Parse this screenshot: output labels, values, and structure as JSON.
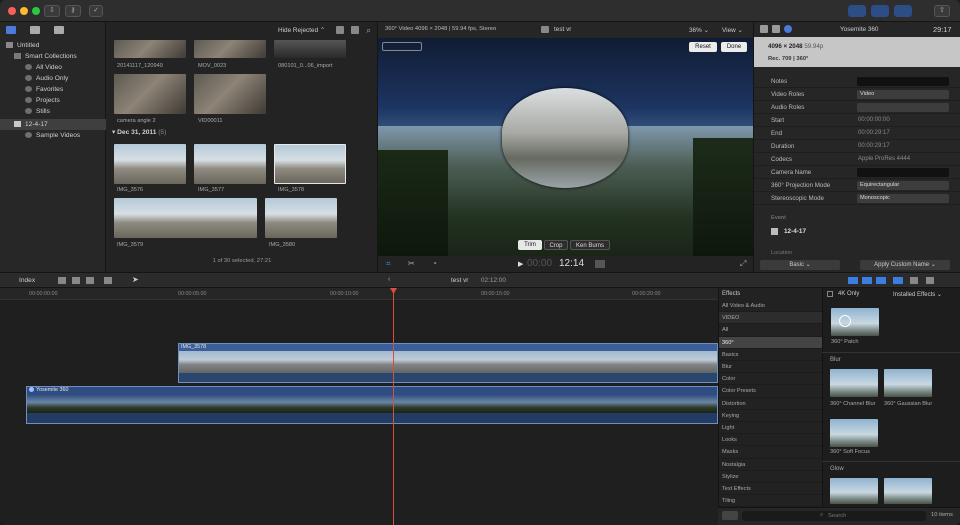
{
  "toolbar": {
    "hide_rejected": "Hide Rejected",
    "zoom": "36%",
    "view": "View",
    "timecode_top": "29:17"
  },
  "sidebar": {
    "library": "Untitled",
    "items": [
      {
        "label": "Smart Collections"
      },
      {
        "label": "All Video"
      },
      {
        "label": "Audio Only"
      },
      {
        "label": "Favorites"
      },
      {
        "label": "Projects"
      },
      {
        "label": "Stills"
      },
      {
        "label": "12-4-17"
      },
      {
        "label": "Sample Videos"
      }
    ]
  },
  "browser": {
    "clips_top": [
      "20141117_120949",
      "MOV_0023",
      "080101_0...06_import"
    ],
    "clips_mid": [
      "camera angle 2",
      "VID00011"
    ],
    "date_header": "Dec 31, 2011",
    "date_count": "(5)",
    "clips_bottom": [
      "IMG_3576",
      "IMG_3577",
      "IMG_3578",
      "IMG_3579",
      "IMG_3580"
    ],
    "status": "1 of 30 selected, 27:21"
  },
  "viewer": {
    "info": "360° Video 4096 × 2048 | 59.94 fps, Stereo",
    "title": "test vr",
    "reset": "Reset",
    "done": "Done",
    "trim": "Trim",
    "crop": "Crop",
    "ken_burns": "Ken Burns",
    "timecode_dim": "00:00",
    "timecode": "12:14"
  },
  "inspector": {
    "title": "Yosemite 360",
    "timecode": "29:17",
    "res": "4096 × 2048",
    "fps": "59.94p",
    "format": "Rec. 709 | 360°",
    "rows": [
      {
        "k": "Notes",
        "v": ""
      },
      {
        "k": "Video Roles",
        "v": "Video"
      },
      {
        "k": "Audio Roles",
        "v": ""
      },
      {
        "k": "Start",
        "v": "00:00:00:00"
      },
      {
        "k": "End",
        "v": "00:00:29:17"
      },
      {
        "k": "Duration",
        "v": "00:00:29:17"
      },
      {
        "k": "Codecs",
        "v": "Apple ProRes 4444"
      },
      {
        "k": "Camera Name",
        "v": ""
      },
      {
        "k": "360° Projection Mode",
        "v": "Equirectangular"
      },
      {
        "k": "Stereoscopic Mode",
        "v": "Monoscopic"
      }
    ],
    "event_label": "Event",
    "event": "12-4-17",
    "location": "Location",
    "basic": "Basic",
    "apply_name": "Apply Custom Name"
  },
  "timeline_bar": {
    "index": "Index",
    "project": "test vr",
    "duration": "02:12:00"
  },
  "ruler": [
    "00:00:00:00",
    "00:00:05:00",
    "00:00:10:00",
    "00:00:15:00",
    "00:00:20:00"
  ],
  "clips": {
    "top": "IMG_3578",
    "main": "Yosemite 360"
  },
  "effects": {
    "header": "Effects",
    "items": [
      "All Video & Audio",
      "VIDEO",
      "All",
      "360°",
      "Basics",
      "Blur",
      "Color",
      "Color Presets",
      "Distortion",
      "Keying",
      "Light",
      "Looks",
      "Masks",
      "Nostalgia",
      "Stylize",
      "Text Effects",
      "Tiling"
    ],
    "selected": 3
  },
  "gallery": {
    "four_k": "4K Only",
    "installed": "Installed Effects",
    "patch": "360° Patch",
    "blur": "Blur",
    "channel_blur": "360° Channel Blur",
    "gaussian_blur": "360° Gaussian Blur",
    "soft_focus": "360° Soft Focus",
    "glow": "Glow",
    "search": "Search",
    "count": "10 items"
  },
  "colors": {
    "accent": "#3d7de0",
    "clip_blue": "#3a5f9a",
    "playhead": "#d8503c"
  }
}
